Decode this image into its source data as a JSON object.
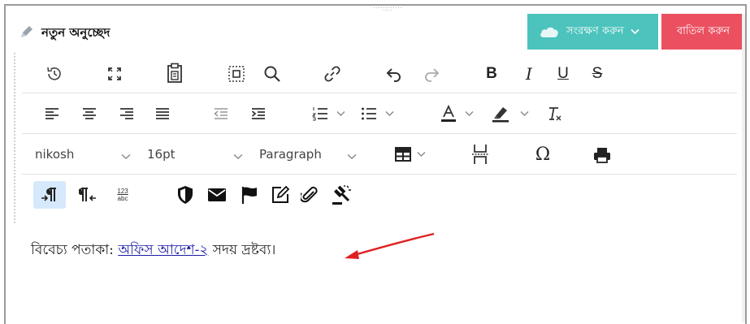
{
  "header": {
    "title": "নতুন অনুচ্ছেদ",
    "save_label": "সংরক্ষণ করুন",
    "cancel_label": "বাতিল করুন",
    "icon": "pencil-icon"
  },
  "toolbar": {
    "row1": [
      "history-icon",
      "fullscreen-icon",
      "paste-icon",
      "select-all-icon",
      "search-icon",
      "link-icon",
      "undo-icon",
      "redo-icon",
      "bold-icon",
      "italic-icon",
      "underline-icon",
      "strikethrough-icon"
    ],
    "row1_text": {
      "bold": "B",
      "italic": "I",
      "underline": "U",
      "strike": "S"
    },
    "row2": [
      "align-left-icon",
      "align-center-icon",
      "align-right-icon",
      "align-justify-icon",
      "outdent-icon",
      "indent-icon",
      "numbered-list-icon",
      "bulleted-list-icon",
      "text-color-icon",
      "highlight-icon",
      "clear-format-icon"
    ],
    "font_family": "nikosh",
    "font_size": "16pt",
    "block_format": "Paragraph",
    "row3": [
      "table-icon",
      "page-break-icon",
      "special-char-icon",
      "print-icon"
    ],
    "omega_char": "Ω",
    "row4": [
      "ltr-icon",
      "rtl-icon",
      "word-count-icon",
      "shield-icon",
      "envelope-icon",
      "flag-icon",
      "edit-icon",
      "attachment-icon",
      "gavel-icon"
    ],
    "word_count_top": "123",
    "word_count_bottom": "abc"
  },
  "content": {
    "prefix": "বিবেচ্য পতাকা: ",
    "link_text": "অফিস আদেশ-২",
    "suffix": " সদয় দ্রষ্টব্য।"
  },
  "colors": {
    "save": "#4cc3bc",
    "cancel": "#ea5060",
    "link": "#1a1aa6",
    "arrow": "#e02020"
  }
}
